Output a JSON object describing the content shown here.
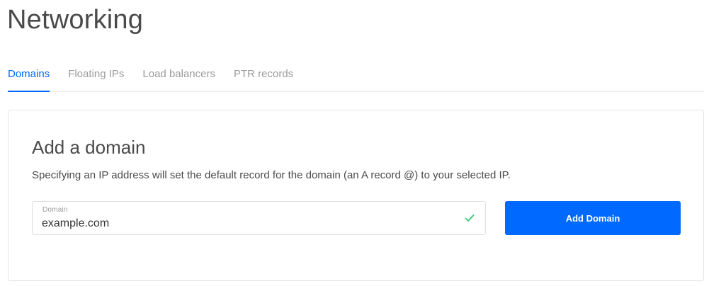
{
  "header": {
    "title": "Networking"
  },
  "tabs": [
    {
      "label": "Domains",
      "active": true
    },
    {
      "label": "Floating IPs",
      "active": false
    },
    {
      "label": "Load balancers",
      "active": false
    },
    {
      "label": "PTR records",
      "active": false
    }
  ],
  "add_domain": {
    "heading": "Add a domain",
    "description": "Specifying an IP address will set the default record for the domain (an A record @) to your selected IP.",
    "field_label": "Domain",
    "field_value": "example.com",
    "field_valid_icon": "check-icon",
    "button_label": "Add Domain"
  },
  "colors": {
    "accent": "#0069ff",
    "valid": "#2ecc71",
    "muted_text": "#9b9b9b"
  }
}
